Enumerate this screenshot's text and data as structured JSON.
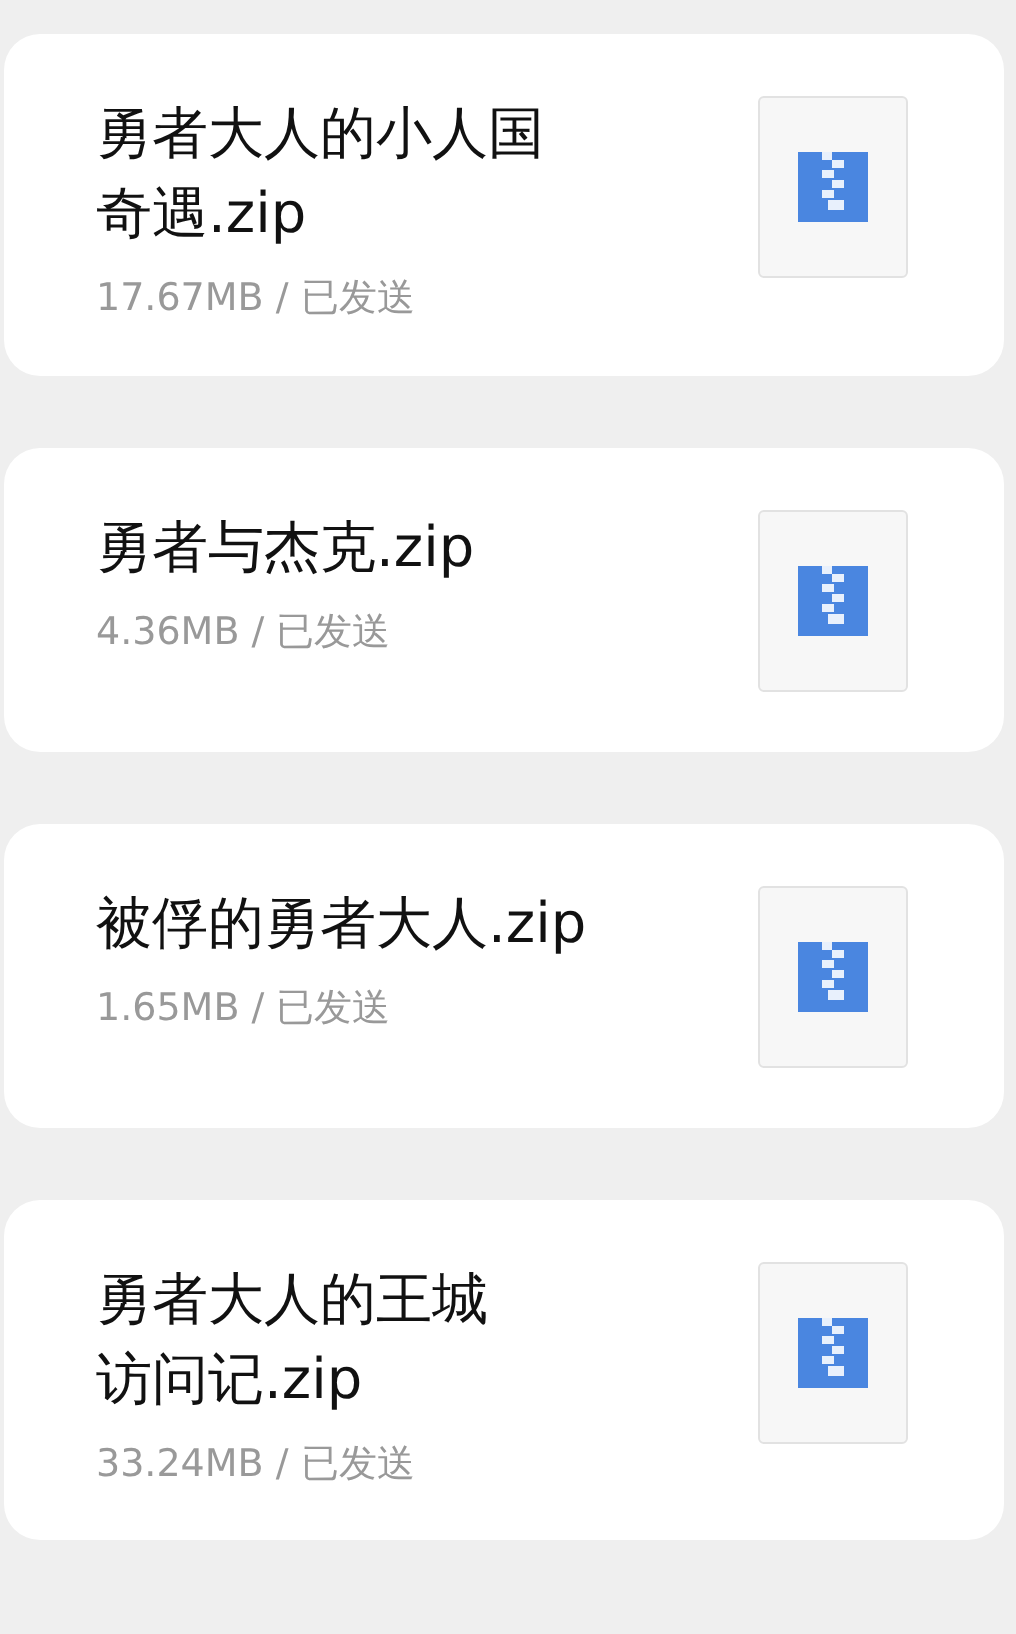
{
  "files": [
    {
      "title_lines": [
        "勇者大人的小人国",
        "奇遇.zip"
      ],
      "meta": "17.67MB / 已发送"
    },
    {
      "title_lines": [
        "勇者与杰克.zip"
      ],
      "meta": "4.36MB / 已发送"
    },
    {
      "title_lines": [
        "被俘的勇者大人.zip"
      ],
      "meta": "1.65MB / 已发送"
    },
    {
      "title_lines": [
        "勇者大人的王城",
        "访问记.zip"
      ],
      "meta": "33.24MB / 已发送"
    }
  ]
}
